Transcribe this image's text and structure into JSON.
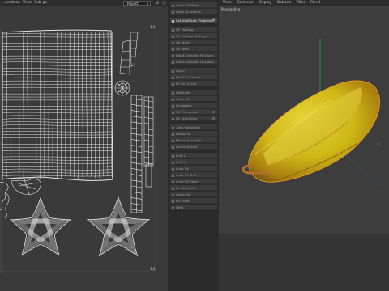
{
  "uv_editor": {
    "menu": [
      "...ssection",
      "View",
      "Sub-ps"
    ],
    "projection_dropdown": "Project",
    "coord_top": "1,1",
    "coord_bottom": "1,0"
  },
  "commands": [
    {
      "label": "Relax UV Mode",
      "highlighted": false
    },
    {
      "label": "Relax All Islands",
      "highlighted": false
    },
    {
      "label": "Set UVW from Projection",
      "highlighted": true,
      "gear": true
    },
    {
      "label": "UV Packing",
      "highlighted": false
    },
    {
      "label": "UV Packing Settings",
      "highlighted": false
    },
    {
      "label": "UV Stitch",
      "highlighted": false
    },
    {
      "label": "UV Weld",
      "highlighted": false
    },
    {
      "label": "Break Selected Polygons",
      "highlighted": false
    },
    {
      "label": "Break Selected Polygons",
      "highlighted": false
    },
    {
      "label": "Flip U",
      "highlighted": false
    },
    {
      "label": "Fit UV to Canvas",
      "highlighted": false
    },
    {
      "label": "Fit UV to Grid",
      "highlighted": false
    },
    {
      "label": "Optimize",
      "highlighted": false
    },
    {
      "label": "Relax UV",
      "highlighted": false
    },
    {
      "label": "Straighten",
      "highlighted": false
    },
    {
      "label": "UV Triangulate",
      "highlighted": false,
      "dot": true
    },
    {
      "label": "UV Straighten",
      "highlighted": false,
      "dot": true
    },
    {
      "label": "Align Horizontal",
      "highlighted": false
    },
    {
      "label": "Rotate 90",
      "highlighted": false
    },
    {
      "label": "Mirror Horizontal",
      "highlighted": false
    },
    {
      "label": "Mirror Vertical",
      "highlighted": false
    },
    {
      "label": "Shift U",
      "highlighted": false
    },
    {
      "label": "Shift V",
      "highlighted": false
    },
    {
      "label": "Snap UV",
      "highlighted": false
    },
    {
      "label": "Snap UV Grid",
      "highlighted": false
    },
    {
      "label": "Snap UV Edge",
      "highlighted": false
    },
    {
      "label": "Pin Selected",
      "highlighted": false
    },
    {
      "label": "Unpin All",
      "highlighted": false
    },
    {
      "label": "Pin Edge",
      "highlighted": false
    },
    {
      "label": "Weld",
      "highlighted": false
    }
  ],
  "viewport": {
    "menu": [
      "View",
      "Cameras",
      "Display",
      "Options",
      "Filter",
      "Panel"
    ],
    "label": "Perspective"
  },
  "colors": {
    "uv_bg": "#3a3a3a",
    "uv_wire": "#e6e6e6",
    "fruit_yellow": "#d7c21a",
    "fruit_orange": "#c98a16",
    "axis_red": "#c0392b",
    "axis_green": "#2aa84a",
    "axis_blue": "#3a5fc9"
  }
}
